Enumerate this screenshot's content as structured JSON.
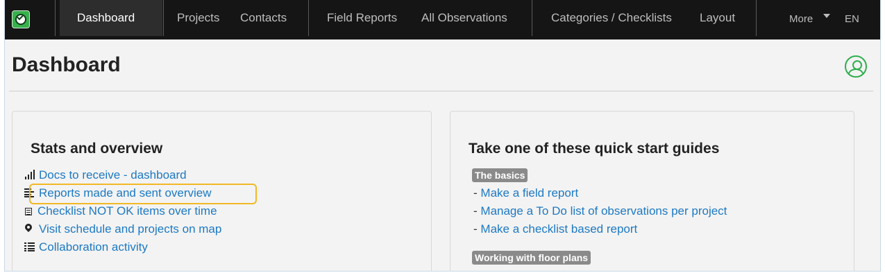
{
  "navbar": {
    "logo_icon": "check-circle-logo-icon",
    "items": [
      {
        "label": "Dashboard",
        "active": true
      },
      {
        "label": "Projects"
      },
      {
        "label": "Contacts"
      },
      {
        "label": "Field Reports"
      },
      {
        "label": "All Observations"
      },
      {
        "label": "Categories / Checklists"
      },
      {
        "label": "Layout"
      },
      {
        "label": "More"
      },
      {
        "label": "EN"
      }
    ]
  },
  "header": {
    "title": "Dashboard",
    "avatar_icon": "user-circle-icon"
  },
  "stats": {
    "title": "Stats and overview",
    "links": [
      {
        "label": "Docs to receive - dashboard",
        "icon": "bar-chart-icon"
      },
      {
        "label": "Reports made and sent overview",
        "icon": "align-left-icon",
        "highlighted": true
      },
      {
        "label": "Checklist NOT OK items over time",
        "icon": "document-list-icon"
      },
      {
        "label": "Visit schedule and projects on map",
        "icon": "map-marker-icon"
      },
      {
        "label": "Collaboration activity",
        "icon": "list-icon"
      }
    ]
  },
  "guides": {
    "title": "Take one of these quick start guides",
    "sections": [
      {
        "badge": "The basics",
        "items": [
          "Make a field report",
          "Manage a To Do list of observations per project",
          "Make a checklist based report"
        ]
      },
      {
        "badge": "Working with floor plans",
        "items": []
      }
    ],
    "dash": "-"
  },
  "colors": {
    "navbar_bg": "#151515",
    "link": "#1d79c2",
    "brand_green": "#38b04d",
    "highlight": "#f2b826",
    "badge_bg": "#8a8a8a"
  }
}
